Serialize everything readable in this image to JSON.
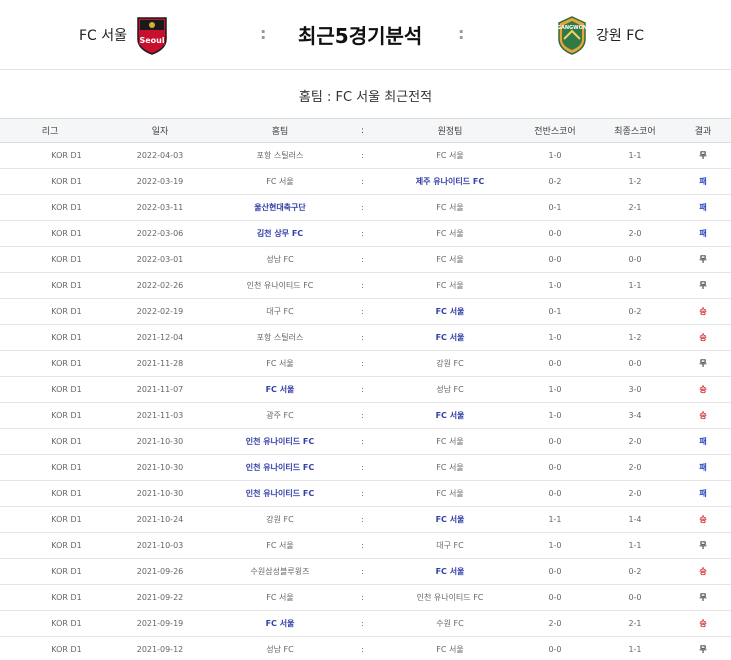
{
  "match": {
    "home_team": "FC 서울",
    "away_team": "강원 FC",
    "title": "최근5경기분석",
    "separator": ":",
    "home_logo_text": "Seoul",
    "away_logo_text": "GANGWON"
  },
  "section_title": "홈팀 : FC 서울 최근전적",
  "table": {
    "headers": [
      "리그",
      "일자",
      "홈팀",
      ":",
      "원정팀",
      "전반스코어",
      "최종스코어",
      "결과"
    ],
    "rows": [
      {
        "league": "KOR D1",
        "date": "2022-04-03",
        "home": "포항 스틸러스",
        "home_bold": false,
        "away": "FC 서울",
        "away_bold": false,
        "half": "1-0",
        "final": "1-1",
        "result": "무"
      },
      {
        "league": "KOR D1",
        "date": "2022-03-19",
        "home": "FC 서울",
        "home_bold": false,
        "away": "제주 유나이티드 FC",
        "away_bold": true,
        "half": "0-2",
        "final": "1-2",
        "result": "패"
      },
      {
        "league": "KOR D1",
        "date": "2022-03-11",
        "home": "울산현대축구단",
        "home_bold": true,
        "away": "FC 서울",
        "away_bold": false,
        "half": "0-1",
        "final": "2-1",
        "result": "패"
      },
      {
        "league": "KOR D1",
        "date": "2022-03-06",
        "home": "김천 상무 FC",
        "home_bold": true,
        "away": "FC 서울",
        "away_bold": false,
        "half": "0-0",
        "final": "2-0",
        "result": "패"
      },
      {
        "league": "KOR D1",
        "date": "2022-03-01",
        "home": "성남 FC",
        "home_bold": false,
        "away": "FC 서울",
        "away_bold": false,
        "half": "0-0",
        "final": "0-0",
        "result": "무"
      },
      {
        "league": "KOR D1",
        "date": "2022-02-26",
        "home": "인천 유나이티드 FC",
        "home_bold": false,
        "away": "FC 서울",
        "away_bold": false,
        "half": "1-0",
        "final": "1-1",
        "result": "무"
      },
      {
        "league": "KOR D1",
        "date": "2022-02-19",
        "home": "대구 FC",
        "home_bold": false,
        "away": "FC 서울",
        "away_bold": true,
        "half": "0-1",
        "final": "0-2",
        "result": "승"
      },
      {
        "league": "KOR D1",
        "date": "2021-12-04",
        "home": "포항 스틸러스",
        "home_bold": false,
        "away": "FC 서울",
        "away_bold": true,
        "half": "1-0",
        "final": "1-2",
        "result": "승"
      },
      {
        "league": "KOR D1",
        "date": "2021-11-28",
        "home": "FC 서울",
        "home_bold": false,
        "away": "강원 FC",
        "away_bold": false,
        "half": "0-0",
        "final": "0-0",
        "result": "무"
      },
      {
        "league": "KOR D1",
        "date": "2021-11-07",
        "home": "FC 서울",
        "home_bold": true,
        "away": "성남 FC",
        "away_bold": false,
        "half": "1-0",
        "final": "3-0",
        "result": "승"
      },
      {
        "league": "KOR D1",
        "date": "2021-11-03",
        "home": "광주 FC",
        "home_bold": false,
        "away": "FC 서울",
        "away_bold": true,
        "half": "1-0",
        "final": "3-4",
        "result": "승"
      },
      {
        "league": "KOR D1",
        "date": "2021-10-30",
        "home": "인천 유나이티드 FC",
        "home_bold": true,
        "away": "FC 서울",
        "away_bold": false,
        "half": "0-0",
        "final": "2-0",
        "result": "패"
      },
      {
        "league": "KOR D1",
        "date": "2021-10-30",
        "home": "인천 유나이티드 FC",
        "home_bold": true,
        "away": "FC 서울",
        "away_bold": false,
        "half": "0-0",
        "final": "2-0",
        "result": "패"
      },
      {
        "league": "KOR D1",
        "date": "2021-10-30",
        "home": "인천 유나이티드 FC",
        "home_bold": true,
        "away": "FC 서울",
        "away_bold": false,
        "half": "0-0",
        "final": "2-0",
        "result": "패"
      },
      {
        "league": "KOR D1",
        "date": "2021-10-24",
        "home": "강원 FC",
        "home_bold": false,
        "away": "FC 서울",
        "away_bold": true,
        "half": "1-1",
        "final": "1-4",
        "result": "승"
      },
      {
        "league": "KOR D1",
        "date": "2021-10-03",
        "home": "FC 서울",
        "home_bold": false,
        "away": "대구 FC",
        "away_bold": false,
        "half": "1-0",
        "final": "1-1",
        "result": "무"
      },
      {
        "league": "KOR D1",
        "date": "2021-09-26",
        "home": "수원삼성블루윙즈",
        "home_bold": false,
        "away": "FC 서울",
        "away_bold": true,
        "half": "0-0",
        "final": "0-2",
        "result": "승"
      },
      {
        "league": "KOR D1",
        "date": "2021-09-22",
        "home": "FC 서울",
        "home_bold": false,
        "away": "인천 유나이티드 FC",
        "away_bold": false,
        "half": "0-0",
        "final": "0-0",
        "result": "무"
      },
      {
        "league": "KOR D1",
        "date": "2021-09-19",
        "home": "FC 서울",
        "home_bold": true,
        "away": "수원 FC",
        "away_bold": false,
        "half": "2-0",
        "final": "2-1",
        "result": "승"
      },
      {
        "league": "KOR D1",
        "date": "2021-09-12",
        "home": "성남 FC",
        "home_bold": false,
        "away": "FC 서울",
        "away_bold": false,
        "half": "0-0",
        "final": "1-1",
        "result": "무"
      }
    ]
  },
  "colors": {
    "win": "#d2232a",
    "loss": "#2b49c6",
    "draw": "#333333",
    "bold_team": "#3340a6"
  }
}
